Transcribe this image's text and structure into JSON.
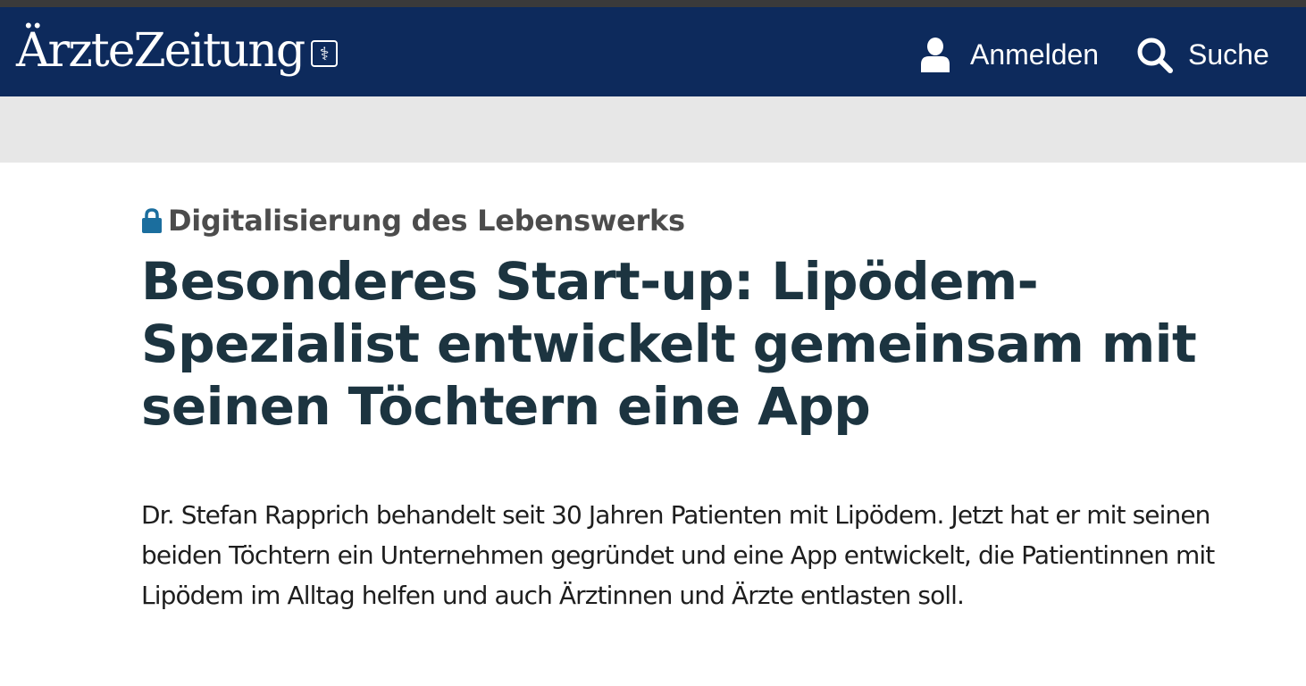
{
  "header": {
    "logo_text": "ÄrzteZeitung",
    "logo_badge_symbol": "⚕",
    "login_label": "Anmelden",
    "search_label": "Suche",
    "login_icon": "user-icon",
    "search_icon": "search-icon",
    "background_color": "#0d2a5c"
  },
  "article": {
    "kicker_icon": "lock-icon",
    "kicker": "Digitalisierung des Lebenswerks",
    "headline": "Besonderes Start-up: Lipödem-Spezialist entwickelt gemeinsam mit seinen Töchtern eine App",
    "lead": "Dr. Stefan Rapprich behandelt seit 30 Jahren Patienten mit Lipödem. Jetzt hat er mit seinen beiden Töchtern ein Unternehmen gegründet und eine App entwickelt, die Patientinnen mit Lipödem im Alltag helfen und auch Ärztinnen und Ärzte entlasten soll.",
    "headline_color": "#1c3440",
    "lock_color": "#1b6e9e"
  }
}
